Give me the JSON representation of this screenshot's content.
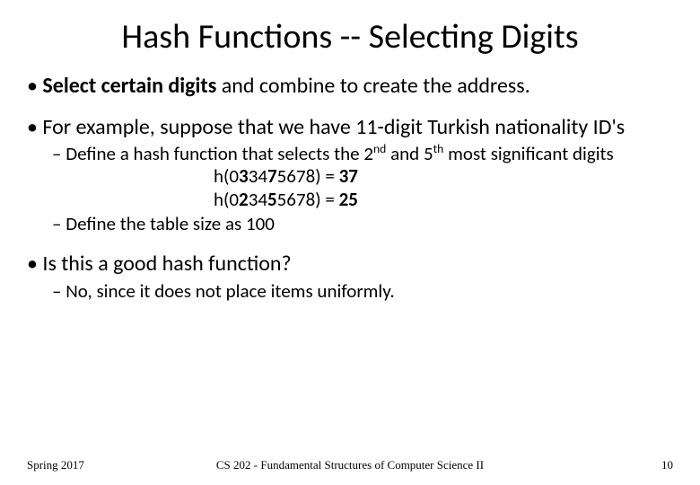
{
  "title": "Hash Functions -- Selecting Digits",
  "b1": {
    "bold": "Select certain digits",
    "rest": " and combine to create the address."
  },
  "b2": "For example, suppose that we have 11-digit Turkish nationality ID's",
  "s1": {
    "pre": "Define a hash function that selects the 2",
    "sup1": "nd",
    "mid": " and 5",
    "sup2": "th",
    "post": " most significant digits"
  },
  "h1": {
    "pre": "h(0",
    "d1": "3",
    "mid1": "34",
    "d2": "7",
    "mid2": "5678) = ",
    "res": "37"
  },
  "h2": {
    "pre": "h(0",
    "d1": "2",
    "mid1": "34",
    "d2": "5",
    "mid2": "5678) = ",
    "res": "25"
  },
  "s2": "Define the table size as 100",
  "b3": "Is this a good hash function?",
  "s3": "No, since it does not place items uniformly.",
  "footer": {
    "left": "Spring 2017",
    "center": "CS 202 - Fundamental Structures of Computer Science II",
    "right": "10"
  }
}
